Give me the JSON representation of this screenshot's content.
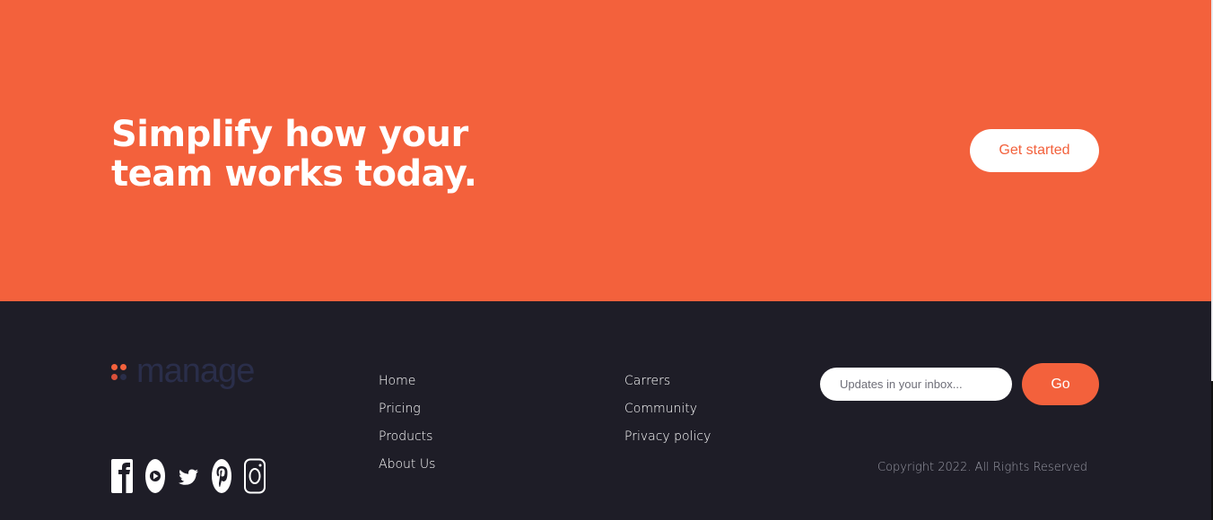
{
  "cta": {
    "title": "Simplify how your team works today.",
    "button_label": "Get started"
  },
  "footer": {
    "logo_text": "manage",
    "nav_primary": [
      "Home",
      "Pricing",
      "Products",
      "About Us"
    ],
    "nav_secondary": [
      "Carrers",
      "Community",
      "Privacy policy"
    ],
    "newsletter": {
      "placeholder": "Updates in your inbox...",
      "button_label": "Go"
    },
    "copyright": "Copyright 2022. All Rights Reserved",
    "social_icons": [
      "facebook-icon",
      "youtube-icon",
      "twitter-icon",
      "pinterest-icon",
      "instagram-icon"
    ]
  },
  "colors": {
    "accent": "#f3613c",
    "footer_bg": "#1e1d27",
    "logo_text": "#2a2e4a",
    "white": "#ffffff"
  }
}
